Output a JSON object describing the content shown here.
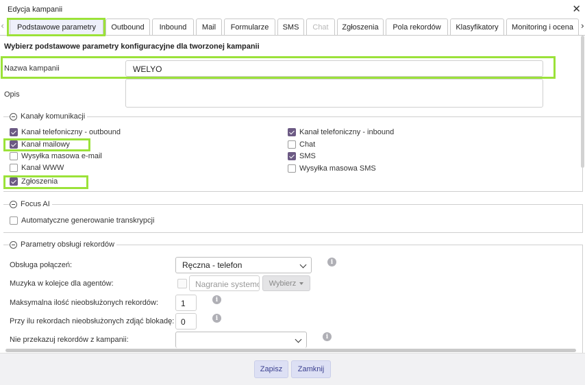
{
  "dialog": {
    "title": "Edycja kampanii"
  },
  "tabs": [
    {
      "label": "Podstawowe parametry"
    },
    {
      "label": "Outbound"
    },
    {
      "label": "Inbound"
    },
    {
      "label": "Mail"
    },
    {
      "label": "Formularze"
    },
    {
      "label": "SMS"
    },
    {
      "label": "Chat"
    },
    {
      "label": "Zgłoszenia"
    },
    {
      "label": "Pola rekordów"
    },
    {
      "label": "Klasyfikatory"
    },
    {
      "label": "Monitoring i ocena"
    }
  ],
  "form": {
    "heading": "Wybierz podstawowe parametry konfiguracyjne dla tworzonej kampanii",
    "name_label": "Nazwa kampanii",
    "name_value": "WELYO",
    "desc_label": "Opis",
    "desc_value": ""
  },
  "channels": {
    "legend": "Kanały komunikacji",
    "items": [
      {
        "label": "Kanał telefoniczny - outbound",
        "checked": true
      },
      {
        "label": "Kanał mailowy",
        "checked": true
      },
      {
        "label": "Wysyłka masowa e-mail",
        "checked": false
      },
      {
        "label": "Kanał WWW",
        "checked": false
      },
      {
        "label": "Zgłoszenia",
        "checked": true
      },
      {
        "label": "Kanał telefoniczny - inbound",
        "checked": true
      },
      {
        "label": "Chat",
        "checked": false
      },
      {
        "label": "SMS",
        "checked": true
      },
      {
        "label": "Wysyłka masowa SMS",
        "checked": false
      }
    ]
  },
  "focus": {
    "legend": "Focus AI",
    "auto_label": "Automatyczne generowanie transkrypcji",
    "auto_checked": false
  },
  "records": {
    "legend": "Parametry obsługi rekordów",
    "calls_label": "Obsługa połączeń:",
    "calls_value": "Ręczna - telefon",
    "music_label": "Muzyka w kolejce dla agentów:",
    "music_placeholder": "Nagranie systemowe",
    "music_button": "Wybierz",
    "max_label": "Maksymalna ilość nieobsłużonych rekordów:",
    "max_value": "1",
    "block_label": "Przy ilu rekordach nieobsłużonych zdjąć blokadę:",
    "block_value": "0",
    "transfer_label": "Nie przekazuj rekordów z kampanii:",
    "transfer_value": ""
  },
  "footer": {
    "save_label": "Zapisz",
    "close_label": "Zamknij"
  },
  "colors": {
    "highlight": "#9be239",
    "checkbox_checked": "#6c5a84",
    "button_bg": "#dde0f4",
    "button_text": "#3a3f8f"
  }
}
